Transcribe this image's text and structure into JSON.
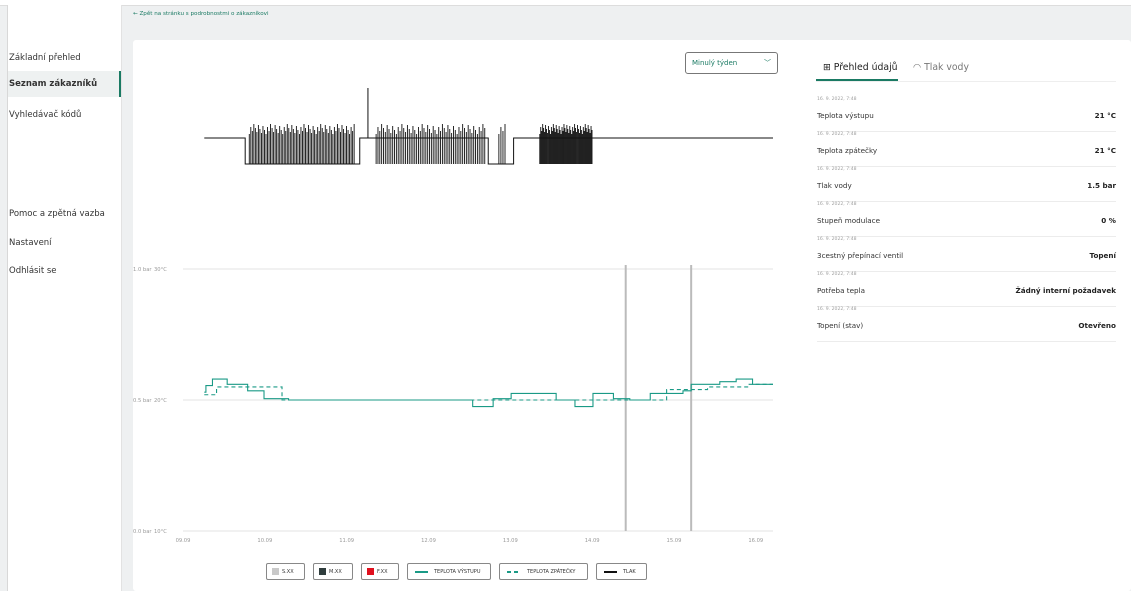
{
  "back_link": "← Zpět na stránku s podrobnostmi o zákazníkovi",
  "sidebar": {
    "items": [
      {
        "label": "Základní přehled"
      },
      {
        "label": "Seznam zákazníků"
      },
      {
        "label": "Vyhledávač kódů"
      },
      {
        "label": "Pomoc a zpětná vazba"
      },
      {
        "label": "Nastavení"
      },
      {
        "label": "Odhlásit se"
      }
    ]
  },
  "period_select": {
    "value": "Minulý týden"
  },
  "tabs": [
    {
      "label": "⊞ Přehled údajů",
      "active": true
    },
    {
      "label": "◠ Tlak vody",
      "active": false
    }
  ],
  "data_overview": {
    "rows": [
      {
        "timestamp": "16. 9. 2022, 7:48",
        "label": "Teplota výstupu",
        "value": "21 °C"
      },
      {
        "timestamp": "16. 9. 2022, 7:48",
        "label": "Teplota zpátečky",
        "value": "21 °C"
      },
      {
        "timestamp": "16. 9. 2022, 7:48",
        "label": "Tlak vody",
        "value": "1.5 bar"
      },
      {
        "timestamp": "16. 9. 2022, 7:48",
        "label": "Stupeň modulace",
        "value": "0 %"
      },
      {
        "timestamp": "16. 9. 2022, 7:48",
        "label": "3cestný přepínací ventil",
        "value": "Topení"
      },
      {
        "timestamp": "16. 9. 2022, 7:48",
        "label": "Potřeba tepla",
        "value": "Žádný interní požadavek"
      },
      {
        "timestamp": "16. 9. 2022, 7:48",
        "label": "Topení (stav)",
        "value": "Otevřeno"
      }
    ]
  },
  "chart_data": {
    "type": "line",
    "x_ticks": [
      "09.09",
      "10.09",
      "11.09",
      "12.09",
      "13.09",
      "14.09",
      "15.09",
      "16.09"
    ],
    "y_ticks_left": [
      "1.0 bar",
      "0.5 bar",
      "0.0 bar"
    ],
    "y_ticks_right": [
      "30°C",
      "20°C",
      "10°C"
    ],
    "ylim_temperature": [
      10,
      30
    ],
    "ylim_pressure": [
      0,
      1
    ],
    "markers": [
      14.5,
      15.3
    ],
    "series": [
      {
        "name": "TEPLOTA VÝSTUPU",
        "color": "#1a9a86",
        "x": [
          9.35,
          9.37,
          9.45,
          9.6,
          9.63,
          9.85,
          9.88,
          10.05,
          10.08,
          10.35,
          10.38,
          11.0,
          11.1,
          11.4,
          11.5,
          11.8,
          11.85,
          12.0,
          12.1,
          12.6,
          12.63,
          12.85,
          12.88,
          13.05,
          13.1,
          13.6,
          13.65,
          13.85,
          13.88,
          14.05,
          14.1,
          14.3,
          14.35,
          14.5,
          14.55,
          14.75,
          14.8,
          15.2,
          15.3,
          15.6,
          15.65,
          15.8,
          15.85,
          16.0,
          16.05,
          16.3
        ],
        "y": [
          20.6,
          21.1,
          21.6,
          21.6,
          21.2,
          21.2,
          20.7,
          20.7,
          20.1,
          20.1,
          20.0,
          20.0,
          20.0,
          20.0,
          20.0,
          20.0,
          20.0,
          20.0,
          20.0,
          20.0,
          19.5,
          19.5,
          20.1,
          20.1,
          20.5,
          20.5,
          20.0,
          20.0,
          19.5,
          19.5,
          20.5,
          20.5,
          20.1,
          20.1,
          20.0,
          20.0,
          20.5,
          20.7,
          21.2,
          21.2,
          21.4,
          21.4,
          21.6,
          21.6,
          21.2,
          21.2
        ]
      },
      {
        "name": "TEPLOTA ZPÁTEČKY",
        "color": "#1a9a86",
        "dashed": true,
        "x": [
          9.35,
          9.5,
          9.9,
          10.3,
          10.6,
          11.0,
          11.5,
          12.0,
          12.5,
          13.0,
          13.5,
          14.0,
          14.5,
          15.0,
          15.5,
          16.0,
          16.3
        ],
        "y": [
          20.4,
          21.0,
          21.0,
          20.0,
          20.0,
          20.0,
          20.0,
          20.0,
          20.0,
          20.0,
          20.0,
          20.0,
          20.0,
          20.8,
          21.0,
          21.2,
          21.2
        ]
      },
      {
        "name": "TLAK",
        "color": "#111111",
        "x": [
          9.35,
          9.85,
          9.85,
          11.2,
          11.2,
          11.4,
          11.4,
          12.8,
          12.8,
          13.15,
          13.15,
          15.4,
          15.4,
          16.3
        ],
        "y": [
          1.5,
          1.5,
          1.0,
          1.0,
          1.5,
          1.5,
          1.0,
          1.0,
          1.0,
          1.0,
          1.5,
          1.5,
          1.5,
          1.5
        ]
      }
    ],
    "legend": [
      {
        "label": "S.XX",
        "color": "#c9c9c9"
      },
      {
        "label": "M.XX",
        "color": "#2f3d3d"
      },
      {
        "label": "F.XX",
        "color": "#e0101e"
      },
      {
        "label": "TEPLOTA VÝSTUPU",
        "color": "#1a9a86"
      },
      {
        "label": "TEPLOTA ZPÁTEČKY",
        "color": "#1a9a86"
      },
      {
        "label": "TLAK",
        "color": "#111111"
      }
    ]
  }
}
